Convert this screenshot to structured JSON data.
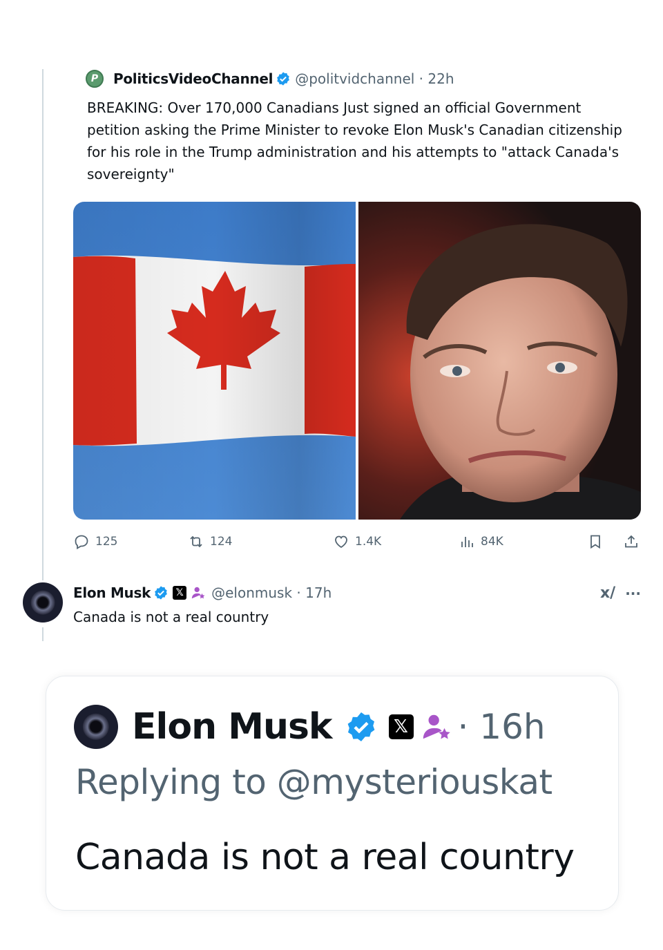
{
  "post": {
    "author_name": "PoliticsVideoChannel",
    "handle_time": "@politvidchannel · 22h",
    "avatar_letter": "P",
    "text": "BREAKING: Over 170,000 Canadians Just signed an official Government petition asking the Prime Minister to revoke Elon Musk's Canadian citizenship for his role in the Trump administration and his attempts to \"attack Canada's sovereignty\"",
    "stats": {
      "replies": "125",
      "reposts": "124",
      "likes": "1.4K",
      "views": "84K"
    },
    "icons": [
      "reply-icon",
      "repost-icon",
      "like-icon",
      "views-icon",
      "bookmark-icon",
      "share-icon"
    ]
  },
  "reply": {
    "author_name": "Elon Musk",
    "badge_x": "𝕏",
    "handle_time": "@elonmusk · 17h",
    "text": "Canada is not a real country",
    "grok_label": "x/",
    "more_label": "···"
  },
  "card": {
    "author_name": "Elon Musk",
    "badge_x": "𝕏",
    "time": "· 16h",
    "replying_to": "Replying to @mysteriouskat",
    "text": "Canada is not a real country"
  },
  "colors": {
    "verified_blue": "#1d9bf0",
    "secondary_text": "#536471",
    "affiliate_purple": "#a855c8",
    "canada_red": "#d52b1e"
  }
}
